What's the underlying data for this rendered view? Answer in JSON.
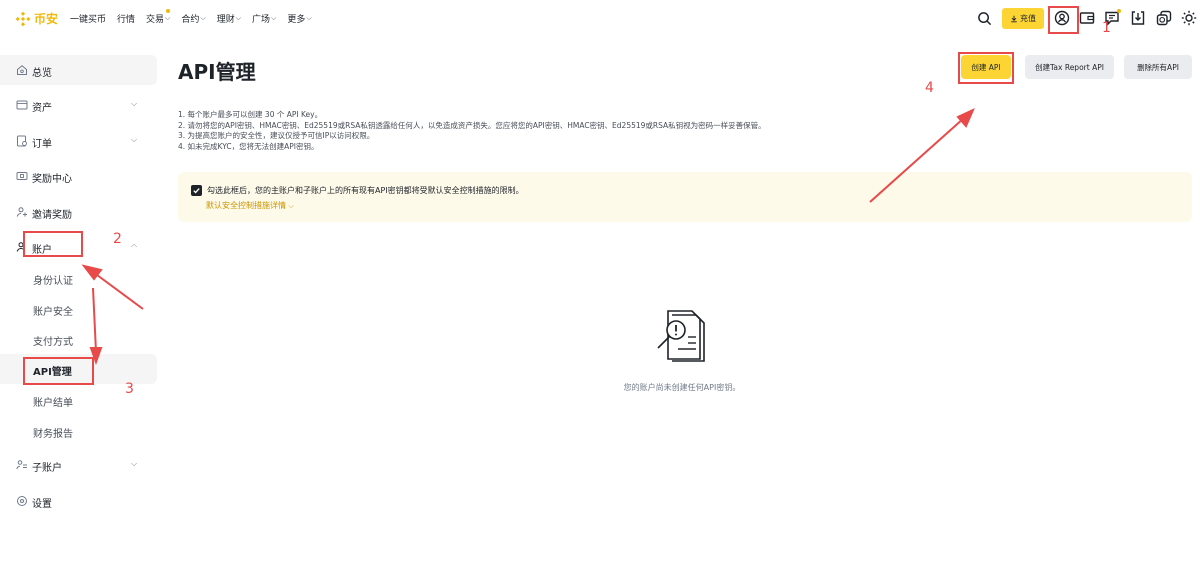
{
  "header": {
    "logo_text": "币安",
    "nav": [
      {
        "label": "一键买币",
        "chevron": false,
        "dot": false
      },
      {
        "label": "行情",
        "chevron": false,
        "dot": false
      },
      {
        "label": "交易",
        "chevron": true,
        "dot": true
      },
      {
        "label": "合约",
        "chevron": true,
        "dot": false
      },
      {
        "label": "理财",
        "chevron": true,
        "dot": false
      },
      {
        "label": "广场",
        "chevron": true,
        "dot": false
      },
      {
        "label": "更多",
        "chevron": true,
        "dot": false
      }
    ],
    "deposit_label": "充值",
    "icons": [
      "search-icon",
      "download-icon",
      "user-icon",
      "wallet-icon",
      "messages-icon",
      "app-download-icon",
      "language-icon",
      "theme-icon"
    ]
  },
  "sidebar": {
    "items": [
      {
        "label": "总览",
        "icon": "dashboard-icon",
        "chevron": false
      },
      {
        "label": "资产",
        "icon": "assets-icon",
        "chevron": true
      },
      {
        "label": "订单",
        "icon": "orders-icon",
        "chevron": true
      },
      {
        "label": "奖励中心",
        "icon": "rewards-icon",
        "chevron": false
      },
      {
        "label": "邀请奖励",
        "icon": "referral-icon",
        "chevron": false
      },
      {
        "label": "账户",
        "icon": "account-icon",
        "chevron": true
      }
    ],
    "account_sub": [
      "身份认证",
      "账户安全",
      "支付方式",
      "API管理",
      "账户结单",
      "财务报告"
    ],
    "items_after": [
      {
        "label": "子账户",
        "icon": "sub-account-icon",
        "chevron": true
      },
      {
        "label": "设置",
        "icon": "settings-icon",
        "chevron": false
      }
    ]
  },
  "main": {
    "title": "API管理",
    "buttons": {
      "create_api": "创建 API",
      "create_tax": "创建Tax Report API",
      "delete_all": "删除所有API"
    },
    "notes": [
      "1. 每个账户最多可以创建 30 个 API Key。",
      "2. 请勿将您的API密钥、HMAC密钥、Ed25519或RSA私钥透露给任何人，以免造成资产损失。您应将您的API密钥、HMAC密钥、Ed25519或RSA私钥视为密码一样妥善保管。",
      "3. 为提高您账户的安全性，建议仅授予可信IP以访问权限。",
      "4. 如未完成KYC，您将无法创建API密钥。"
    ],
    "notice": {
      "text": "勾选此框后，您的主账户和子账户上的所有现有API密钥都将受默认安全控制措施的限制。",
      "link": "默认安全控制措施详情"
    },
    "empty_text": "您的账户尚未创建任何API密钥。"
  },
  "annotations": {
    "color": "#e84a4a",
    "numbers": [
      "1",
      "2",
      "3",
      "4"
    ]
  },
  "colors": {
    "brand": "#f0b90b",
    "primary_button": "#fcd535",
    "notice_bg": "#fefaea",
    "link": "#c99400"
  }
}
